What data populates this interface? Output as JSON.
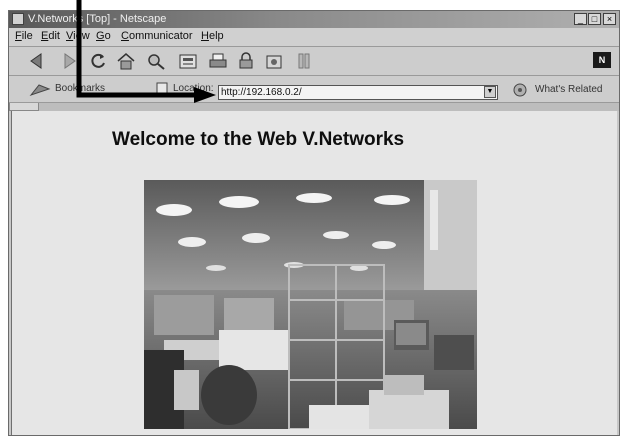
{
  "window": {
    "title": "V.Networks [Top] - Netscape",
    "minimize": "_",
    "maximize": "□",
    "close": "×"
  },
  "menu": [
    "File",
    "Edit",
    "View",
    "Go",
    "Communicator",
    "Help"
  ],
  "toolbar_icons": [
    "back-icon",
    "forward-icon",
    "reload-icon",
    "home-icon",
    "search-icon",
    "my-netscape-icon",
    "print-icon",
    "security-icon",
    "shop-icon",
    "stop-icon"
  ],
  "navbar": {
    "bookmarks_label": "Bookmarks",
    "location_label": "Location:",
    "url": "http://192.168.0.2/",
    "whats_related": "What's Related"
  },
  "page": {
    "heading": "Welcome to the Web V.Networks"
  }
}
